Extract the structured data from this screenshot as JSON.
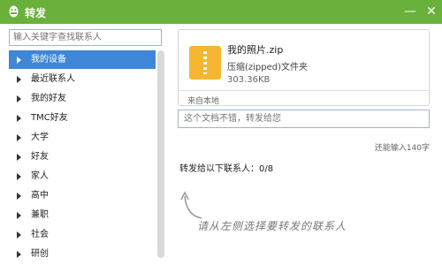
{
  "window": {
    "title": "转发",
    "minimize_glyph": "—",
    "close_glyph": "✕",
    "logo_icon": "qq-penguin-icon"
  },
  "search": {
    "placeholder": "输入关键字查找联系人"
  },
  "contacts": [
    {
      "label": "我的设备",
      "selected": true
    },
    {
      "label": "最近联系人"
    },
    {
      "label": "我的好友"
    },
    {
      "label": "TMC好友"
    },
    {
      "label": "大学"
    },
    {
      "label": "好友"
    },
    {
      "label": "家人"
    },
    {
      "label": "高中"
    },
    {
      "label": "兼职"
    },
    {
      "label": "社会"
    },
    {
      "label": "研创"
    }
  ],
  "file": {
    "name": "我的照片.zip",
    "type": "压缩(zipped)文件夹",
    "size": "303.36KB",
    "source": "来自本地",
    "icon": "zip-file-icon"
  },
  "message": {
    "placeholder": "这个文档不错，转发给您"
  },
  "remaining": "还能输入140字",
  "forward_label": "转发给以下联系人：0/8",
  "hint": "请从左侧选择要转发的联系人",
  "colors": {
    "titlebar": "#69b13a",
    "selected": "#3f86d6"
  }
}
